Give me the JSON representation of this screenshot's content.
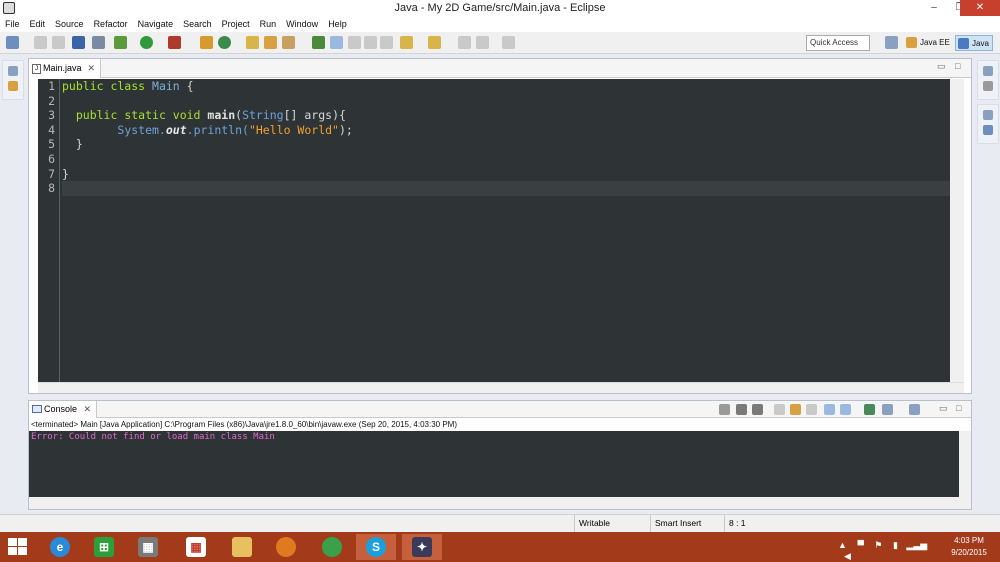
{
  "window": {
    "title": "Java - My 2D Game/src/Main.java - Eclipse",
    "minimize": "–",
    "restore": "❐",
    "close": "✕"
  },
  "menu": [
    "File",
    "Edit",
    "Source",
    "Refactor",
    "Navigate",
    "Search",
    "Project",
    "Run",
    "Window",
    "Help"
  ],
  "toolbar": {
    "quick_access": "Quick Access",
    "perspectives": [
      "Java EE",
      "Java"
    ]
  },
  "editor": {
    "tab_label": "Main.java",
    "tab_icon": "J",
    "close_glyph": "✕",
    "line_numbers": [
      "1",
      "2",
      "3",
      "4",
      "5",
      "6",
      "7",
      "8"
    ],
    "code": {
      "l1_kw": "public class ",
      "l1_name": "Main",
      "l1_brace": " {",
      "l3_kw": "public static void ",
      "l3_fn": "main",
      "l3_open": "(",
      "l3_type": "String",
      "l3_rest": "[] args){",
      "l4_sys": "System.",
      "l4_out": "out",
      "l4_println": ".println(",
      "l4_str": "\"Hello World\"",
      "l4_end": ");",
      "l5": "}",
      "l7": "}"
    }
  },
  "console": {
    "tab_label": "Console",
    "close_glyph": "✕",
    "terminated": "<terminated> Main [Java Application] C:\\Program Files (x86)\\Java\\jre1.8.0_60\\bin\\javaw.exe (Sep 20, 2015, 4:03:30 PM)",
    "output": "Error: Could not find or load main class Main"
  },
  "status": {
    "writable": "Writable",
    "insert_mode": "Smart Insert",
    "position": "8 : 1"
  },
  "taskbar": {
    "time": "4:03 PM",
    "date": "9/20/2015",
    "apps": [
      "internet-explorer",
      "store",
      "app",
      "app-grid",
      "file-explorer",
      "firefox",
      "chrome",
      "skype",
      "eclipse"
    ]
  },
  "colors": {
    "editor_bg": "#2e3336",
    "keyword": "#a6e22e",
    "string": "#f0a030",
    "error_text": "#e06ad0",
    "taskbar": "#a33a1a"
  }
}
